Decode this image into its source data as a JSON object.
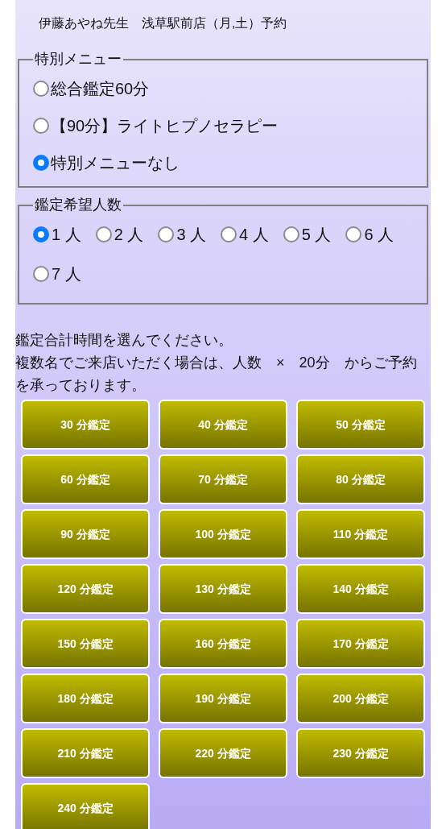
{
  "header": "伊藤あやね先生　浅草駅前店（月,土）予約",
  "special_menu": {
    "legend": "特別メニュー",
    "options": [
      {
        "label": "総合鑑定60分",
        "selected": false
      },
      {
        "label": "【90分】ライトヒプノセラピー",
        "selected": false
      },
      {
        "label": "特別メニューなし",
        "selected": true
      }
    ]
  },
  "people": {
    "legend": "鑑定希望人数",
    "options": [
      {
        "label": "1 人",
        "selected": true
      },
      {
        "label": "2 人",
        "selected": false
      },
      {
        "label": "3 人",
        "selected": false
      },
      {
        "label": "4 人",
        "selected": false
      },
      {
        "label": "5 人",
        "selected": false
      },
      {
        "label": "6 人",
        "selected": false
      },
      {
        "label": "7 人",
        "selected": false
      }
    ]
  },
  "instructions": [
    "鑑定合計時間を選んでください。",
    "複数名でご来店いただく場合は、人数　×　20分　からご予約を承っております。"
  ],
  "duration_buttons": [
    "30 分鑑定",
    "40 分鑑定",
    "50 分鑑定",
    "60 分鑑定",
    "70 分鑑定",
    "80 分鑑定",
    "90 分鑑定",
    "100 分鑑定",
    "110 分鑑定",
    "120 分鑑定",
    "130 分鑑定",
    "140 分鑑定",
    "150 分鑑定",
    "160 分鑑定",
    "170 分鑑定",
    "180 分鑑定",
    "190 分鑑定",
    "200 分鑑定",
    "210 分鑑定",
    "220 分鑑定",
    "230 分鑑定",
    "240 分鑑定"
  ]
}
